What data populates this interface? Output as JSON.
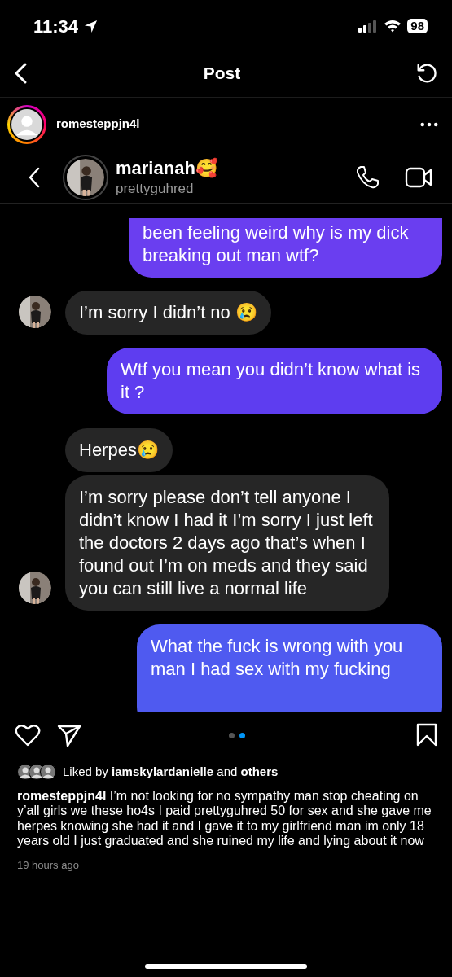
{
  "status_bar": {
    "time": "11:34",
    "battery": "98"
  },
  "header": {
    "title": "Post"
  },
  "post_author": {
    "username": "romesteppjn4l",
    "has_story": true
  },
  "dm": {
    "name": "marianah🥰",
    "handle": "prettyguhred",
    "messages": [
      {
        "kind": "sent",
        "text": "been feeling weird why is my dick breaking out man wtf?"
      },
      {
        "kind": "received",
        "text": "I’m sorry I didn’t no 😢",
        "show_avatar": true
      },
      {
        "kind": "sent",
        "text": "Wtf you mean you didn’t know what is it ?"
      },
      {
        "kind": "received",
        "text": "Herpes😢",
        "show_avatar": false
      },
      {
        "kind": "received",
        "text": "I’m sorry please don’t tell anyone I didn’t know I had it I’m sorry I just left the doctors 2 days ago that’s when I found out I’m on meds and they said you can still live a normal life",
        "show_avatar": true
      },
      {
        "kind": "sent",
        "text": "What the fuck is wrong with you man I had sex with my fucking"
      }
    ]
  },
  "carousel_dots": [
    {
      "selected": false
    },
    {
      "selected": true
    }
  ],
  "likes": {
    "prefix": "Liked by",
    "user": "iamskylardanielle",
    "middle": "and",
    "suffix": "others"
  },
  "caption": {
    "username": "romesteppjn4l",
    "text": "I’m not looking for no sympathy man stop cheating on y’all girls we these ho4s I paid prettyguhred  50 for sex and she gave me herpes knowing she had it and I gave it to my girlfriend man im only 18 years old I just graduated and she ruined my life and lying about it now"
  },
  "timestamp": "19 hours ago"
}
